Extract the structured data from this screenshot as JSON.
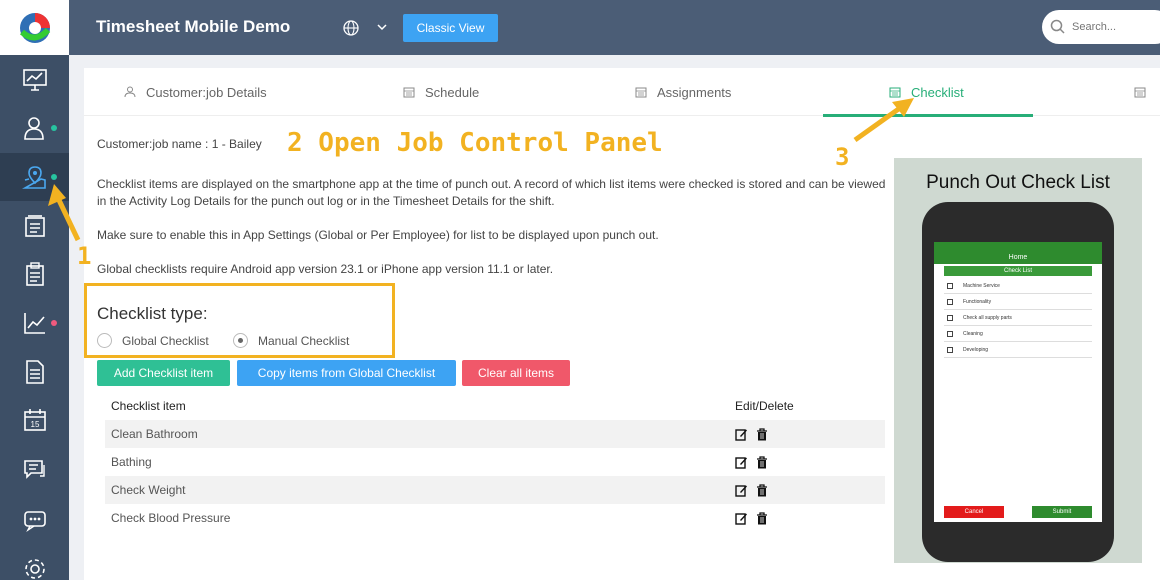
{
  "header": {
    "title": "Timesheet Mobile Demo",
    "classic_view_label": "Classic View",
    "search_placeholder": "Search..."
  },
  "tabs": [
    {
      "label": "Customer:job Details",
      "icon": "user-icon"
    },
    {
      "label": "Schedule",
      "icon": "calendar-icon"
    },
    {
      "label": "Assignments",
      "icon": "calendar-icon"
    },
    {
      "label": "Checklist",
      "icon": "calendar-icon",
      "active": true
    }
  ],
  "main": {
    "job_name": "Customer:job name : 1 - Bailey",
    "paragraphs": [
      "Checklist items are displayed on the smartphone app at the time of punch out. A record of which list items were checked is stored and can be viewed in the Activity Log Details for the punch out log or in the Timesheet Details for the shift.",
      "Make sure to enable this in App Settings (Global or Per Employee) for list to be displayed upon punch out.",
      "Global checklists require Android app version 23.1 or iPhone app version 11.1 or later."
    ],
    "checklist_type_label": "Checklist type:",
    "radio_global": "Global Checklist",
    "radio_manual": "Manual Checklist",
    "selected_type": "Manual Checklist",
    "buttons": {
      "add": "Add Checklist item",
      "copy": "Copy items from Global Checklist",
      "clear": "Clear all items"
    },
    "table": {
      "headers": [
        "Checklist item",
        "Edit/Delete"
      ],
      "rows": [
        "Clean Bathroom",
        "Bathing",
        "Check Weight",
        "Check Blood Pressure"
      ]
    }
  },
  "annotations": {
    "a1": "1",
    "a2": "2 Open Job Control Panel",
    "a3": "3"
  },
  "promo": {
    "title": "Punch Out Check List",
    "home": "Home",
    "check_list": "Check List",
    "items": [
      "Machine Service",
      "Functionality",
      "Check all supply parts",
      "Cleaning",
      "Developing"
    ],
    "cancel": "Cancel",
    "submit": "Submit"
  },
  "colors": {
    "sidebar": "#3d4f66",
    "topbar": "#4b5d76",
    "accent_green": "#27ae78",
    "blue": "#3da3f3",
    "red": "#f0586a",
    "annotation": "#f2b221"
  }
}
